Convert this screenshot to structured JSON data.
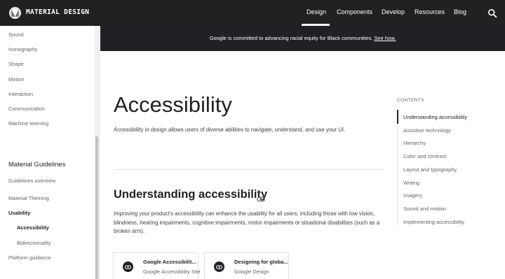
{
  "topbar": {
    "brand": "MATERIAL DESIGN",
    "nav": [
      "Design",
      "Components",
      "Develop",
      "Resources",
      "Blog"
    ],
    "active_nav": "Design"
  },
  "banner": {
    "text": "Google is committed to advancing racial equity for Black communities.",
    "link": "See how."
  },
  "sidebar": {
    "items_top": [
      "Sound",
      "Iconography",
      "Shape",
      "Motion",
      "Interaction",
      "Communication",
      "Machine learning"
    ],
    "section_heading": "Material Guidelines",
    "items_bottom": [
      {
        "label": "Guidelines overview"
      },
      {
        "label": "Material Theming"
      },
      {
        "label": "Usability"
      },
      {
        "label": "Accessibility"
      },
      {
        "label": "Bidirectionality"
      },
      {
        "label": "Platform guidance"
      }
    ]
  },
  "main": {
    "title": "Accessibility",
    "intro": "Accessibility in design allows users of diverse abilities to navigate, understand, and use your UI.",
    "section_title": "Understanding accessibility",
    "paragraph": "Improving your product's accessibility can enhance the usability for all users, including those with low vision, blindness, hearing impairments, cognitive impairments, motor impairments or situational disabilities (such as a broken arm).",
    "cards": [
      {
        "title": "Google Accessibilit...",
        "subtitle": "Google Accessibility Site"
      },
      {
        "title": "Designing for globa...",
        "subtitle": "Google Design"
      }
    ]
  },
  "toc": {
    "label": "CONTENTS",
    "items": [
      "Understanding accessibility",
      "Assistive technology",
      "Hierarchy",
      "Color and contrast",
      "Layout and typography",
      "Writing",
      "Imagery",
      "Sound and motion",
      "Implementing accessibility"
    ]
  },
  "colors": {
    "topbar_bg": "#212121",
    "banner_bg": "#202124",
    "text_primary": "#202124",
    "text_secondary": "#5f6368"
  },
  "icons": {
    "logo": "material-logo-icon",
    "search": "search-icon",
    "link": "link-icon",
    "card": "link-icon"
  }
}
